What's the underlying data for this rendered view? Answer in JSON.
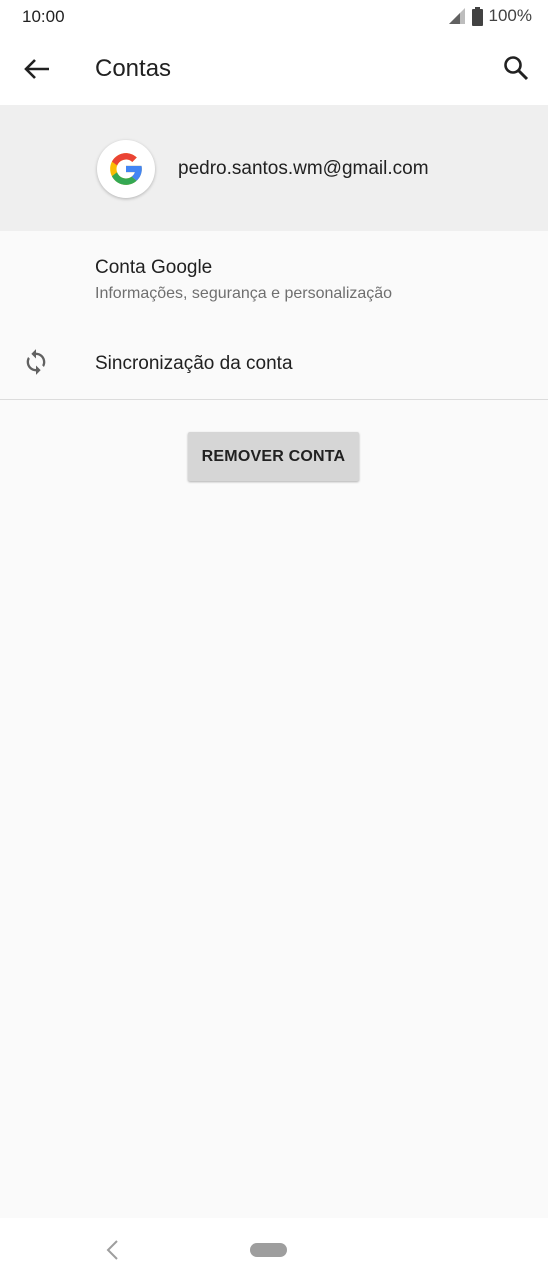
{
  "status_bar": {
    "time": "10:00",
    "battery": "100%",
    "icons": [
      "signal-icon",
      "battery-icon"
    ]
  },
  "app_bar": {
    "title": "Contas",
    "icons": [
      "back-arrow-icon",
      "search-icon"
    ]
  },
  "account": {
    "email": "pedro.santos.wm@gmail.com",
    "logo": "google-logo-icon"
  },
  "items": {
    "google_account": {
      "title": "Conta Google",
      "subtitle": "Informações, segurança e personalização"
    },
    "sync": {
      "label": "Sincronização da conta",
      "icon": "sync-icon"
    }
  },
  "actions": {
    "remove_label": "REMOVER CONTA"
  },
  "nav_bar": {
    "icons": [
      "nav-back-icon",
      "nav-home-pill"
    ]
  },
  "colors": {
    "header_bg": "#efefef",
    "page_bg": "#fafafa",
    "button_bg": "#d6d6d6",
    "google_blue": "#4285F4",
    "google_red": "#EA4335",
    "google_yellow": "#FBBC05",
    "google_green": "#34A853"
  }
}
